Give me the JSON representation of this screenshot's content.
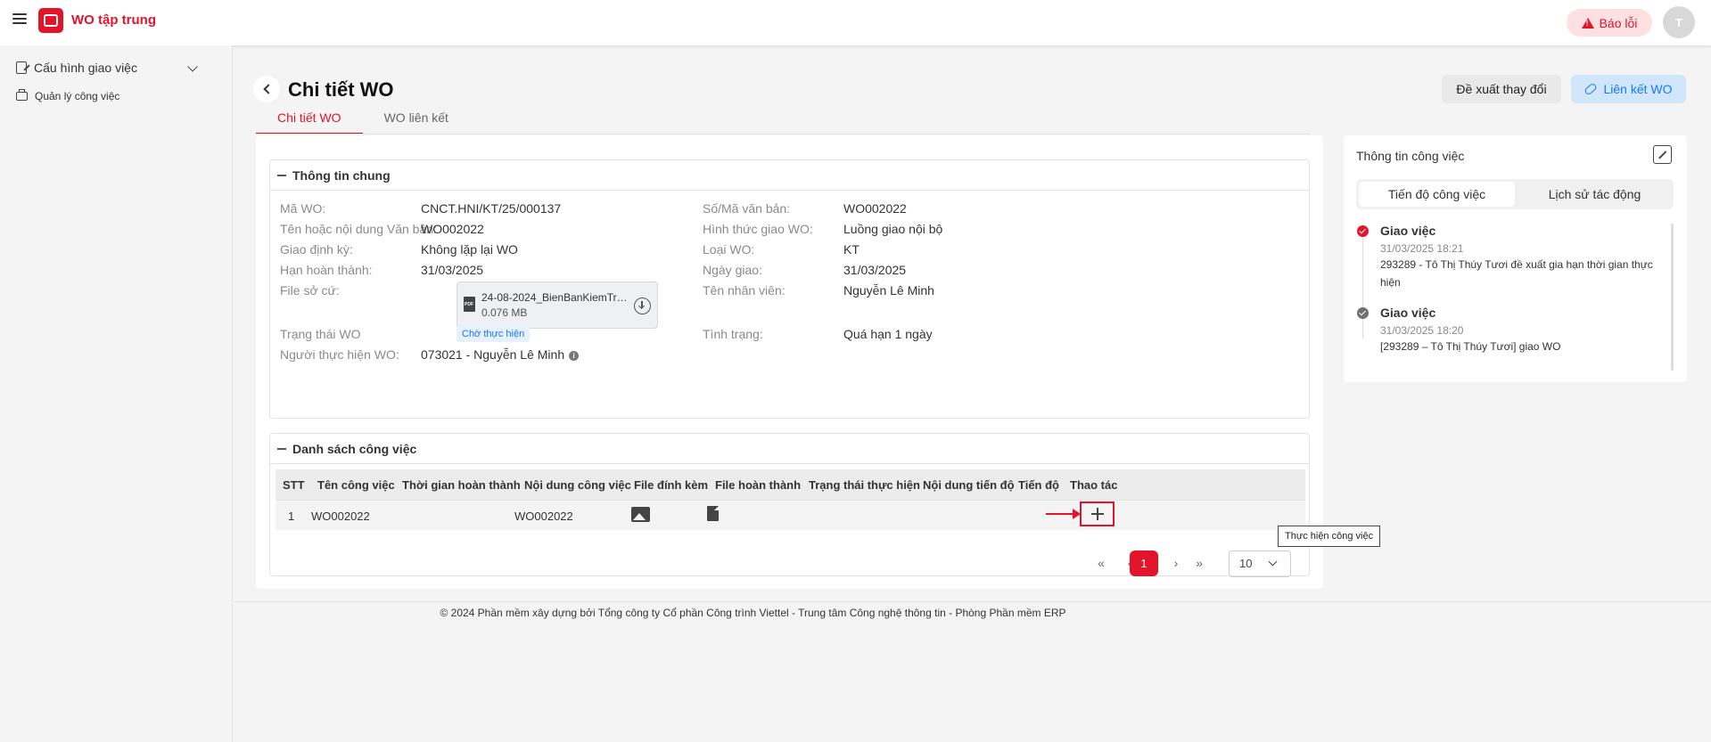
{
  "header": {
    "app_title": "WO tập trung",
    "report_label": "Báo lỗi",
    "avatar_initial": "T"
  },
  "sidebar": {
    "items": [
      {
        "label": "Cấu hình giao việc"
      },
      {
        "label": "Quản lý công việc"
      }
    ]
  },
  "page": {
    "title": "Chi tiết WO",
    "propose_label": "Đề xuất thay đổi",
    "link_label": "Liên kết WO",
    "tabs": [
      {
        "label": "Chi tiết WO"
      },
      {
        "label": "WO liên kết"
      }
    ]
  },
  "general_info": {
    "section_title": "Thông tin chung",
    "fields": {
      "ma_wo": {
        "label": "Mã WO:",
        "value": "CNCT.HNI/KT/25/000137"
      },
      "so_van_ban": {
        "label": "Số/Mã văn bản:",
        "value": "WO002022"
      },
      "ten_van_ban": {
        "label": "Tên hoặc nội dung Văn bản:",
        "value": "WO002022"
      },
      "hinh_thuc": {
        "label": "Hình thức giao WO:",
        "value": "Luồng giao nội bộ"
      },
      "giao_dinh_ky": {
        "label": "Giao định kỳ:",
        "value": "Không lặp lại WO"
      },
      "loai_wo": {
        "label": "Loại WO:",
        "value": "KT"
      },
      "han_hoan_thanh": {
        "label": "Hạn hoàn thành:",
        "value": "31/03/2025"
      },
      "ngay_giao": {
        "label": "Ngày giao:",
        "value": "31/03/2025"
      },
      "file_so_cu": {
        "label": "File sở cứ:"
      },
      "ten_nhan_vien": {
        "label": "Tên nhân viên:",
        "value": "Nguyễn Lê Minh"
      },
      "trang_thai": {
        "label": "Trạng thái WO",
        "value": "Chờ thực hiện"
      },
      "tinh_trang": {
        "label": "Tình trạng:",
        "value": "Quá hạn 1 ngày"
      },
      "nguoi_thuc_hien": {
        "label": "Người thực hiện WO:",
        "value": "073021 - Nguyễn Lê Minh"
      }
    },
    "file": {
      "name": "24-08-2024_BienBanKiemTra...",
      "size": "0.076 MB"
    }
  },
  "tasks": {
    "section_title": "Danh sách công việc",
    "columns": [
      "STT",
      "Tên công việc",
      "Thời gian hoàn thành",
      "Nội dung công việc",
      "File đính kèm",
      "File hoàn thành",
      "Trạng thái thực hiện",
      "Nội dung tiến độ",
      "Tiến độ",
      "Thao tác"
    ],
    "rows": [
      {
        "stt": "1",
        "ten": "WO002022",
        "thoi_gian": "",
        "noi_dung": "WO002022"
      }
    ],
    "tooltip": "Thực hiện công việc"
  },
  "pagination": {
    "current_page": "1",
    "page_size": "10",
    "first": "«",
    "prev": "‹",
    "next": "›",
    "last": "»"
  },
  "footer": "© 2024 Phần mềm xây dựng bởi Tổng công ty Cổ phần Công trình Viettel - Trung tâm Công nghệ thông tin - Phòng Phần mềm ERP",
  "work_info": {
    "title": "Thông tin công việc",
    "seg_tabs": [
      "Tiến độ công việc",
      "Lịch sử tác động"
    ],
    "events": [
      {
        "title": "Giao việc",
        "time": "31/03/2025 18:21",
        "desc": "293289 - Tô Thị Thúy Tươi đề xuất gia hạn thời gian thực hiện"
      },
      {
        "title": "Giao việc",
        "time": "31/03/2025 18:20",
        "desc": "[293289 – Tô Thị Thúy Tươi] giao WO"
      }
    ]
  },
  "colors": {
    "brand": "#e3142a",
    "link": "#1677ff",
    "background": "#f4f4f4"
  },
  "icons": [
    "hamburger-icon",
    "logo-icon",
    "warning-icon",
    "chevron-down-icon",
    "edit-icon",
    "briefcase-icon",
    "back-icon",
    "link-icon",
    "pdf-icon",
    "download-icon",
    "info-icon",
    "image-icon",
    "file-icon",
    "plus-icon",
    "collapse-icon",
    "check-icon"
  ]
}
